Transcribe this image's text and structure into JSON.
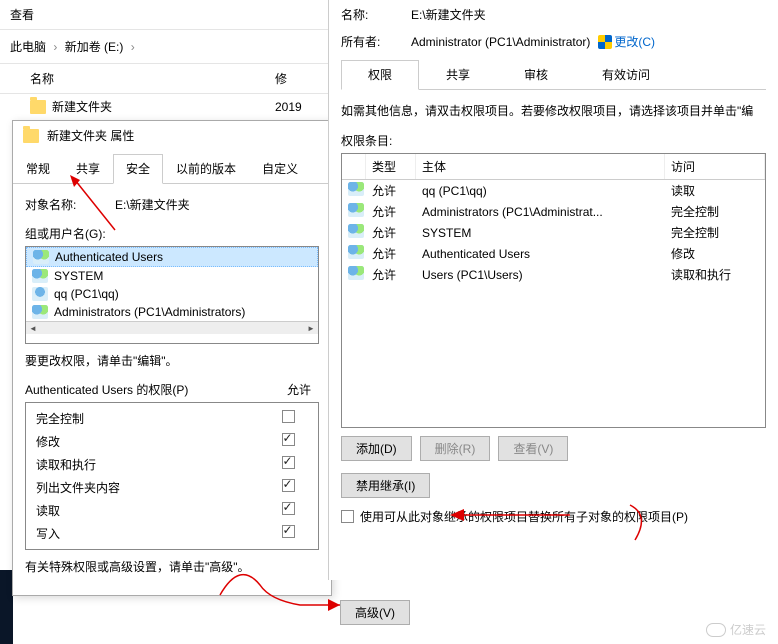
{
  "explorer": {
    "title": "查看",
    "breadcrumb": {
      "root": "此电脑",
      "drive": "新加卷 (E:)"
    },
    "columns": {
      "name": "名称",
      "date": "修"
    },
    "folder": {
      "name": "新建文件夹",
      "date": "2019"
    }
  },
  "props": {
    "window_title": "新建文件夹 属性",
    "tabs": {
      "general": "常规",
      "share": "共享",
      "security": "安全",
      "prev": "以前的版本",
      "custom": "自定义"
    },
    "object_label": "对象名称:",
    "object_value": "E:\\新建文件夹",
    "groups_label": "组或用户名(G):",
    "users": [
      {
        "icon": "group",
        "label": "Authenticated Users",
        "selected": true
      },
      {
        "icon": "group",
        "label": "SYSTEM",
        "selected": false
      },
      {
        "icon": "user",
        "label": "qq (PC1\\qq)",
        "selected": false
      },
      {
        "icon": "group",
        "label": "Administrators (PC1\\Administrators)",
        "selected": false
      }
    ],
    "edit_hint": "要更改权限，请单击\"编辑\"。",
    "perm_header_name": "Authenticated Users 的权限(P)",
    "perm_header_allow": "允许",
    "permissions": [
      {
        "name": "完全控制",
        "allow": false
      },
      {
        "name": "修改",
        "allow": true
      },
      {
        "name": "读取和执行",
        "allow": true
      },
      {
        "name": "列出文件夹内容",
        "allow": true
      },
      {
        "name": "读取",
        "allow": true
      },
      {
        "name": "写入",
        "allow": true
      }
    ],
    "adv_hint": "有关特殊权限或高级设置，请单击\"高级\"。",
    "adv_btn": "高级(V)"
  },
  "adv": {
    "name_label": "名称:",
    "name_value": "E:\\新建文件夹",
    "owner_label": "所有者:",
    "owner_value": "Administrator (PC1\\Administrator)",
    "change_link": "更改(C)",
    "tabs": {
      "perm": "权限",
      "share": "共享",
      "audit": "审核",
      "effective": "有效访问"
    },
    "instruction": "如需其他信息，请双击权限项目。若要修改权限项目，请选择该项目并单击\"编",
    "entries_label": "权限条目:",
    "columns": {
      "type": "类型",
      "principal": "主体",
      "access": "访问"
    },
    "entries": [
      {
        "type": "允许",
        "principal": "qq (PC1\\qq)",
        "access": "读取"
      },
      {
        "type": "允许",
        "principal": "Administrators (PC1\\Administrat...",
        "access": "完全控制"
      },
      {
        "type": "允许",
        "principal": "SYSTEM",
        "access": "完全控制"
      },
      {
        "type": "允许",
        "principal": "Authenticated Users",
        "access": "修改"
      },
      {
        "type": "允许",
        "principal": "Users (PC1\\Users)",
        "access": "读取和执行"
      }
    ],
    "add_btn": "添加(D)",
    "remove_btn": "删除(R)",
    "view_btn": "查看(V)",
    "disable_inherit_btn": "禁用继承(I)",
    "replace_label": "使用可从此对象继承的权限项目替换所有子对象的权限项目(P)"
  },
  "watermark": "亿速云"
}
